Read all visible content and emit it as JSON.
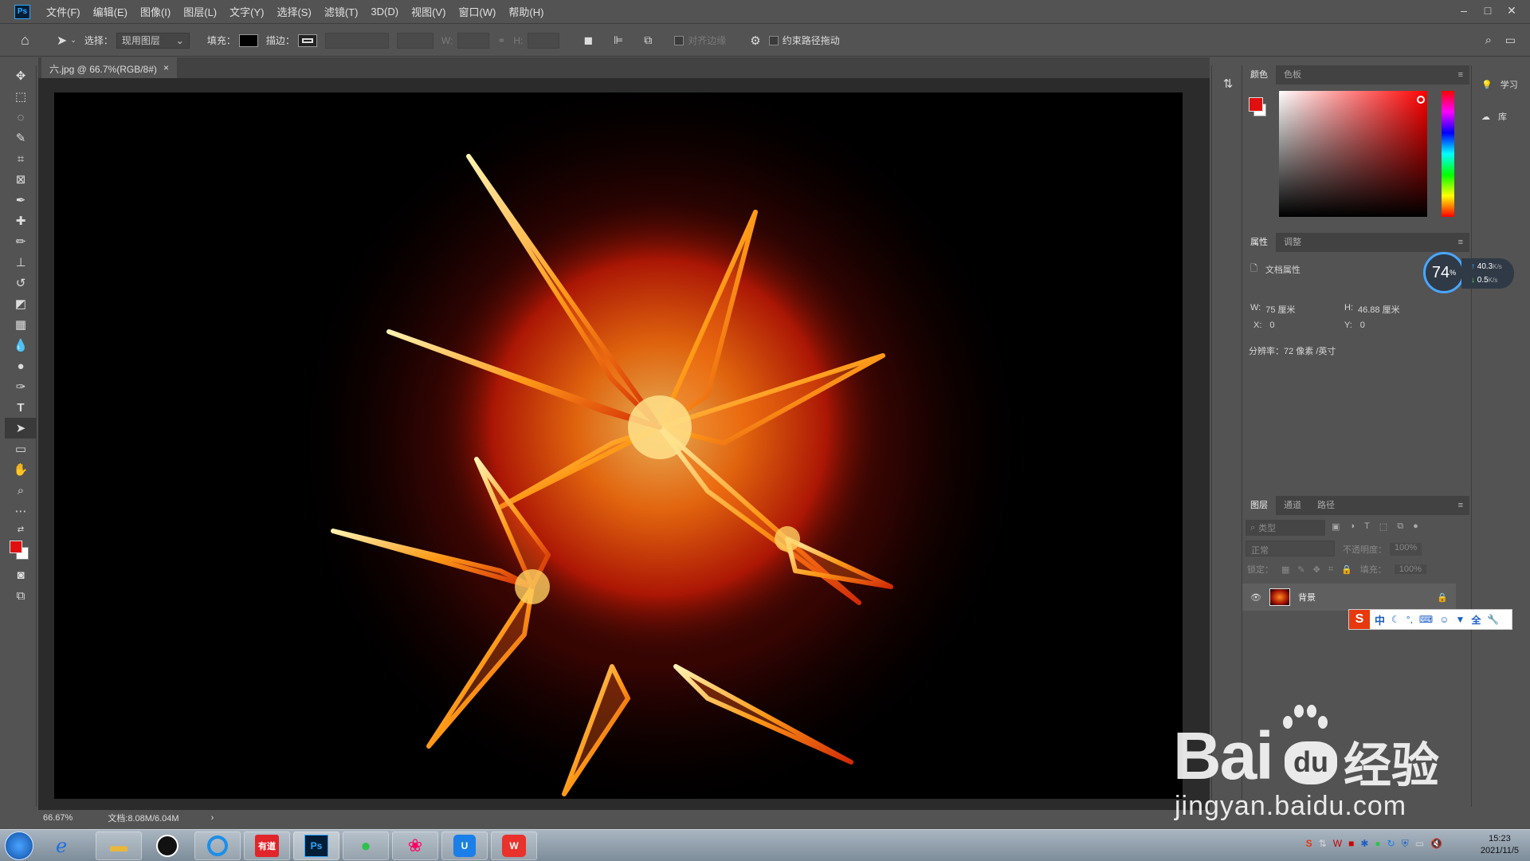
{
  "app": {
    "logo": "Ps"
  },
  "menu": [
    "文件(F)",
    "编辑(E)",
    "图像(I)",
    "图层(L)",
    "文字(Y)",
    "选择(S)",
    "滤镜(T)",
    "3D(D)",
    "视图(V)",
    "窗口(W)",
    "帮助(H)"
  ],
  "window_controls": {
    "minimize": "–",
    "maximize": "□",
    "close": "✕"
  },
  "options": {
    "select_label": "选择：",
    "select_value": "现用图层",
    "fill_label": "填充：",
    "stroke_label": "描边：",
    "w_label": "W:",
    "h_label": "H:",
    "align_edges": "对齐边缘",
    "constrain_path": "约束路径拖动"
  },
  "document": {
    "tab_title": "六.jpg @ 66.7%(RGB/8#)",
    "tab_close": "×"
  },
  "status": {
    "zoom": "66.67%",
    "doc_size": "文档:8.08M/6.04M",
    "arrow": "›"
  },
  "color_panel": {
    "tabs": [
      "颜色",
      "色板"
    ],
    "foreground": "#e01010",
    "background": "#ffffff"
  },
  "properties_panel": {
    "tabs": [
      "属性",
      "调整"
    ],
    "title": "文档属性",
    "w_label": "W:",
    "w_value": "75 厘米",
    "h_label": "H:",
    "h_value": "46.88 厘米",
    "x_label": "X:",
    "x_value": "0",
    "y_label": "Y:",
    "y_value": "0",
    "resolution": "分辨率：72 像素 /英寸"
  },
  "layers_panel": {
    "tabs": [
      "图层",
      "通道",
      "路径"
    ],
    "filter_placeholder": "类型",
    "blend_mode": "正常",
    "opacity_label": "不透明度：",
    "opacity_value": "100%",
    "lock_label": "锁定：",
    "fill_label": "填充：",
    "fill_value": "100%",
    "layers": [
      {
        "name": "背景",
        "visible": true,
        "locked": true
      }
    ]
  },
  "learn_panel": {
    "learn": "学习",
    "library": "库"
  },
  "net_meter": {
    "percent": "74",
    "unit": "%",
    "up": "40.3",
    "up_unit": "K/s",
    "down": "0.5",
    "down_unit": "K/s"
  },
  "ime": {
    "logo": "S",
    "mode": "中"
  },
  "watermark": {
    "brand": "Bai",
    "brand2": "du",
    "suffix": "经验",
    "url": "jingyan.baidu.com"
  },
  "taskbar": {
    "time": "15:23",
    "date": "2021/11/5",
    "youdao": "有道"
  }
}
